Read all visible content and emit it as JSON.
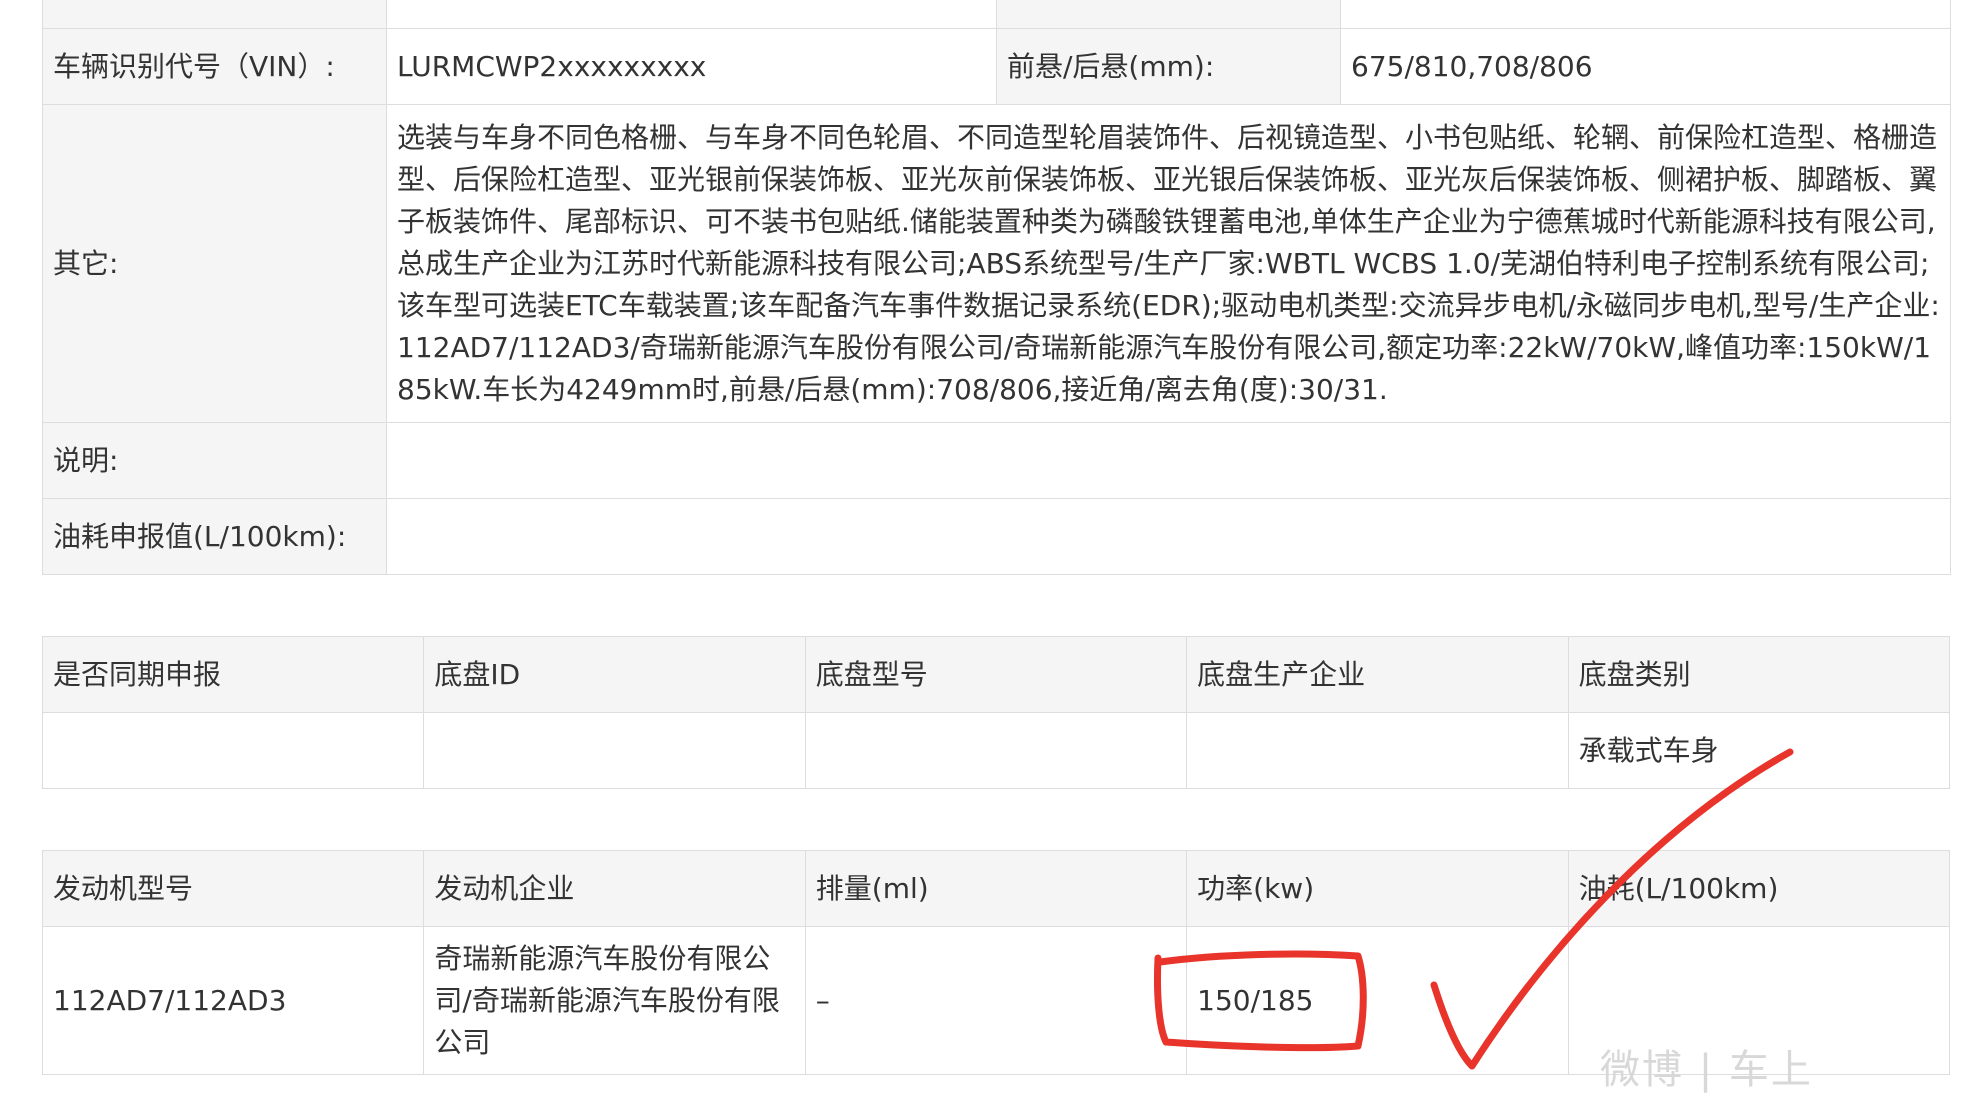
{
  "spec_table": {
    "row_partial": {
      "label": "",
      "value": "",
      "label2": "",
      "value2": ""
    },
    "vin": {
      "label": "车辆识别代号（VIN）:",
      "value": "LURMCWP2xxxxxxxxx",
      "label2": "前悬/后悬(mm):",
      "value2": "675/810,708/806"
    },
    "other": {
      "label": "其它:",
      "value": "选装与车身不同色格栅、与车身不同色轮眉、不同造型轮眉装饰件、后视镜造型、小书包贴纸、轮辋、前保险杠造型、格栅造型、后保险杠造型、亚光银前保装饰板、亚光灰前保装饰板、亚光银后保装饰板、亚光灰后保装饰板、侧裙护板、脚踏板、翼子板装饰件、尾部标识、可不装书包贴纸.储能装置种类为磷酸铁锂蓄电池,单体生产企业为宁德蕉城时代新能源科技有限公司,总成生产企业为江苏时代新能源科技有限公司;ABS系统型号/生产厂家:WBTL WCBS 1.0/芜湖伯特利电子控制系统有限公司;该车型可选装ETC车载装置;该车配备汽车事件数据记录系统(EDR);驱动电机类型:交流异步电机/永磁同步电机,型号/生产企业:112AD7/112AD3/奇瑞新能源汽车股份有限公司/奇瑞新能源汽车股份有限公司,额定功率:22kW/70kW,峰值功率:150kW/185kW.车长为4249mm时,前悬/后悬(mm):708/806,接近角/离去角(度):30/31."
    },
    "note": {
      "label": "说明:",
      "value": ""
    },
    "fuel": {
      "label": "油耗申报值(L/100km):",
      "value": ""
    }
  },
  "chassis_table": {
    "headers": [
      "是否同期申报",
      "底盘ID",
      "底盘型号",
      "底盘生产企业",
      "底盘类别"
    ],
    "row": [
      "",
      "",
      "",
      "",
      "承载式车身"
    ]
  },
  "engine_table": {
    "headers": [
      "发动机型号",
      "发动机企业",
      "排量(ml)",
      "功率(kw)",
      "油耗(L/100km)"
    ],
    "row": [
      "112AD7/112AD3",
      "奇瑞新能源汽车股份有限公司/奇瑞新能源汽车股份有限公司",
      "–",
      "150/185",
      ""
    ]
  },
  "annotation": {
    "color": "#e8342a"
  },
  "watermark": {
    "text": "微博 | 车上"
  }
}
